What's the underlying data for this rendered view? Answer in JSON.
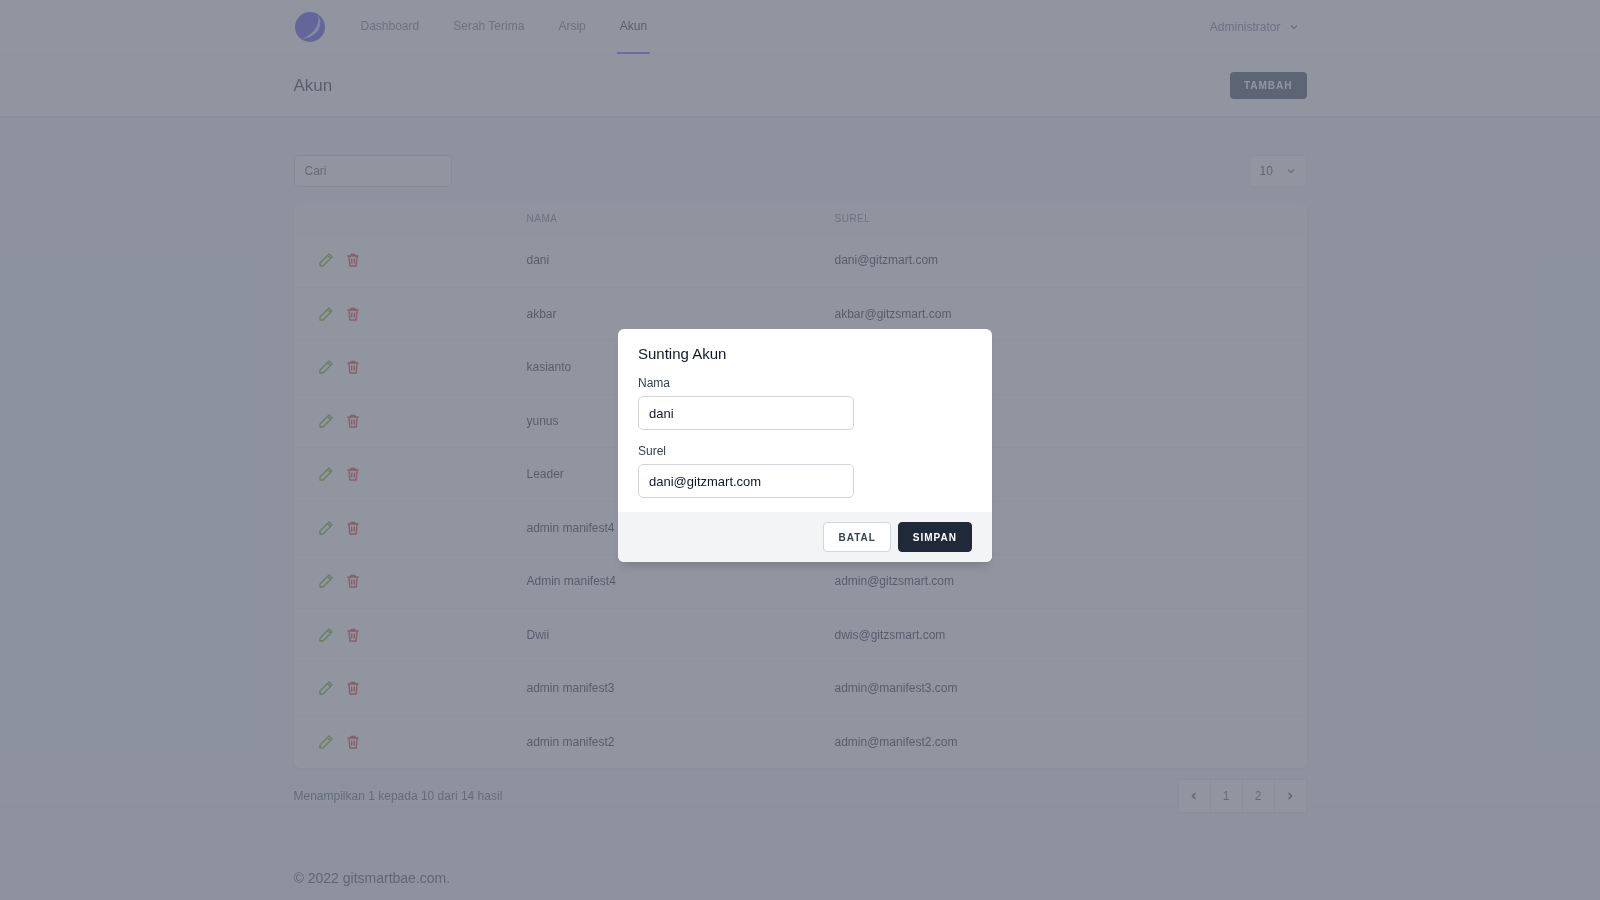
{
  "nav": {
    "items": [
      {
        "label": "Dashboard",
        "selected": false
      },
      {
        "label": "Serah Terima",
        "selected": false
      },
      {
        "label": "Arsip",
        "selected": false
      },
      {
        "label": "Akun",
        "selected": true
      }
    ],
    "user": "Administrator"
  },
  "header": {
    "title": "Akun",
    "add_button": "TAMBAH"
  },
  "search": {
    "placeholder": "Cari"
  },
  "per_page": "10",
  "table": {
    "columns": [
      "NAMA",
      "SUREL"
    ],
    "rows": [
      {
        "name": "dani",
        "email": "dani@gitzmart.com"
      },
      {
        "name": "akbar",
        "email": "akbar@gitzsmart.com"
      },
      {
        "name": "kasianto"
      },
      {
        "name": "yunus"
      },
      {
        "name": "Leader"
      },
      {
        "name": "admin manifest4"
      },
      {
        "name": "Admin manifest4",
        "email": "admin@gitzsmart.com"
      },
      {
        "name": "Dwii",
        "email": "dwis@gitzsmart.com"
      },
      {
        "name": "admin manifest3",
        "email": "admin@manifest3.com"
      },
      {
        "name": "admin manifest2",
        "email": "admin@manifest2.com"
      }
    ]
  },
  "pagination": {
    "summary": "Menampilkan 1 kepada 10 dari 14 hasil",
    "pages": [
      "1",
      "2"
    ]
  },
  "footer": "© 2022 gitsmartbae.com.",
  "modal": {
    "title": "Sunting Akun",
    "fields": [
      {
        "label": "Nama",
        "value": "dani"
      },
      {
        "label": "Surel",
        "value": "dani@gitzmart.com"
      }
    ],
    "buttons": [
      {
        "label": "BATAL",
        "kind": "secondary"
      },
      {
        "label": "SIMPAN",
        "kind": "primary"
      }
    ]
  }
}
